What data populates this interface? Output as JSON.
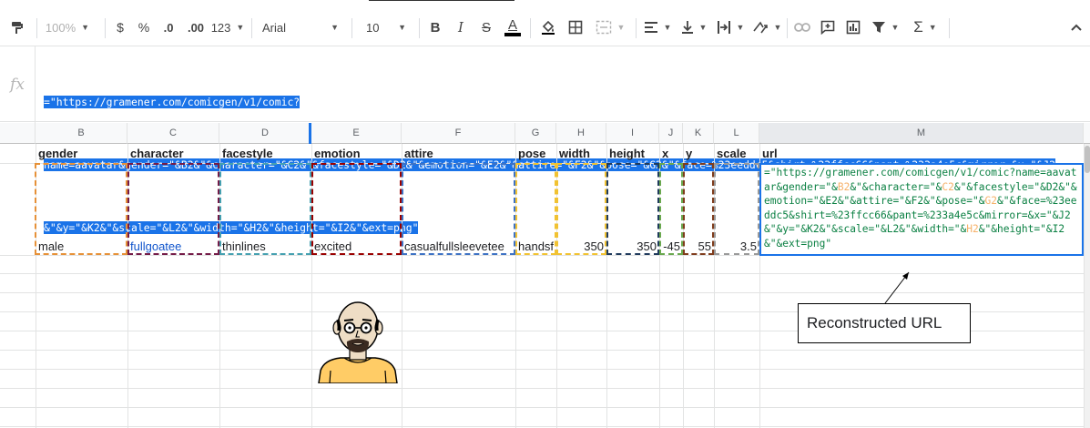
{
  "toolbar": {
    "zoom": "100%",
    "currency": "$",
    "percent": "%",
    "decrease_decimals": ".0",
    "increase_decimals": ".00",
    "more_formats": "123",
    "font": "Arial",
    "font_size": "10",
    "bold": "B",
    "italic": "I",
    "strike": "S",
    "text_color": "A",
    "sum": "Σ"
  },
  "formula_bar": {
    "fx": "fx",
    "lines": [
      "=\"https://gramener.com/comicgen/v1/comic?",
      "name=aavatar&gender=\"&B2&\"&character=\"&C2&\"&facestyle=\"&D2&\"&emotion=\"&E2&\"&attire=\"&F2&\"&pose=\"&G2&\"&face=%23eeddc5&shirt=%23ffcc66&pant=%233a4e5c&mirror=&x=\"&J2",
      "&\"&y=\"&K2&\"&scale=\"&L2&\"&width=\"&H2&\"&height=\"&I2&\"&ext=png\""
    ]
  },
  "columns": [
    "B",
    "C",
    "D",
    "E",
    "F",
    "G",
    "H",
    "I",
    "J",
    "K",
    "L",
    "M"
  ],
  "headers": [
    "gender",
    "character",
    "facestyle",
    "emotion",
    "attire",
    "pose",
    "width",
    "height",
    "x",
    "y",
    "scale",
    "url"
  ],
  "values": [
    "male",
    "fullgoatee",
    "thinlines",
    "excited",
    "casualfullsleevetee",
    "handsf",
    "350",
    "350",
    "-45",
    "55",
    "3.5"
  ],
  "url_cell": {
    "parts": [
      "=\"https://gramener.com/comicgen/v1/comic?name=aavatar&gender=\"&",
      "B2",
      "&\"&character=\"&",
      "C2",
      "&\"&facestyle=\"&D2&\"&emotion=\"&E2&\"&attire=\"&F2&\"&pose=\"&",
      "G2",
      "&\"&face=%23eeddc5&shirt=%23ffcc66&pant=%233a4e5c&mirror=&x=\"&J2&\"&y=\"&K2&\"&scale=\"&L2&\"&width=\"&",
      "H2",
      "&\"&height=\"&I2&\"&ext=png\""
    ]
  },
  "callout": "Reconstructed URL",
  "colors": {
    "accent": "#1a73e8",
    "link_text": "#1155cc",
    "box_gender": "#e69138",
    "box_character": "#741b47",
    "box_facestyle": "#45a0b0",
    "box_emotion": "#990000",
    "box_attire": "#3d72c4",
    "box_pose": "#f1c232",
    "box_height": "#1f3a5c",
    "box_x": "#6aa84f",
    "box_y": "#7f3c1c",
    "box_scale": "#999999"
  }
}
